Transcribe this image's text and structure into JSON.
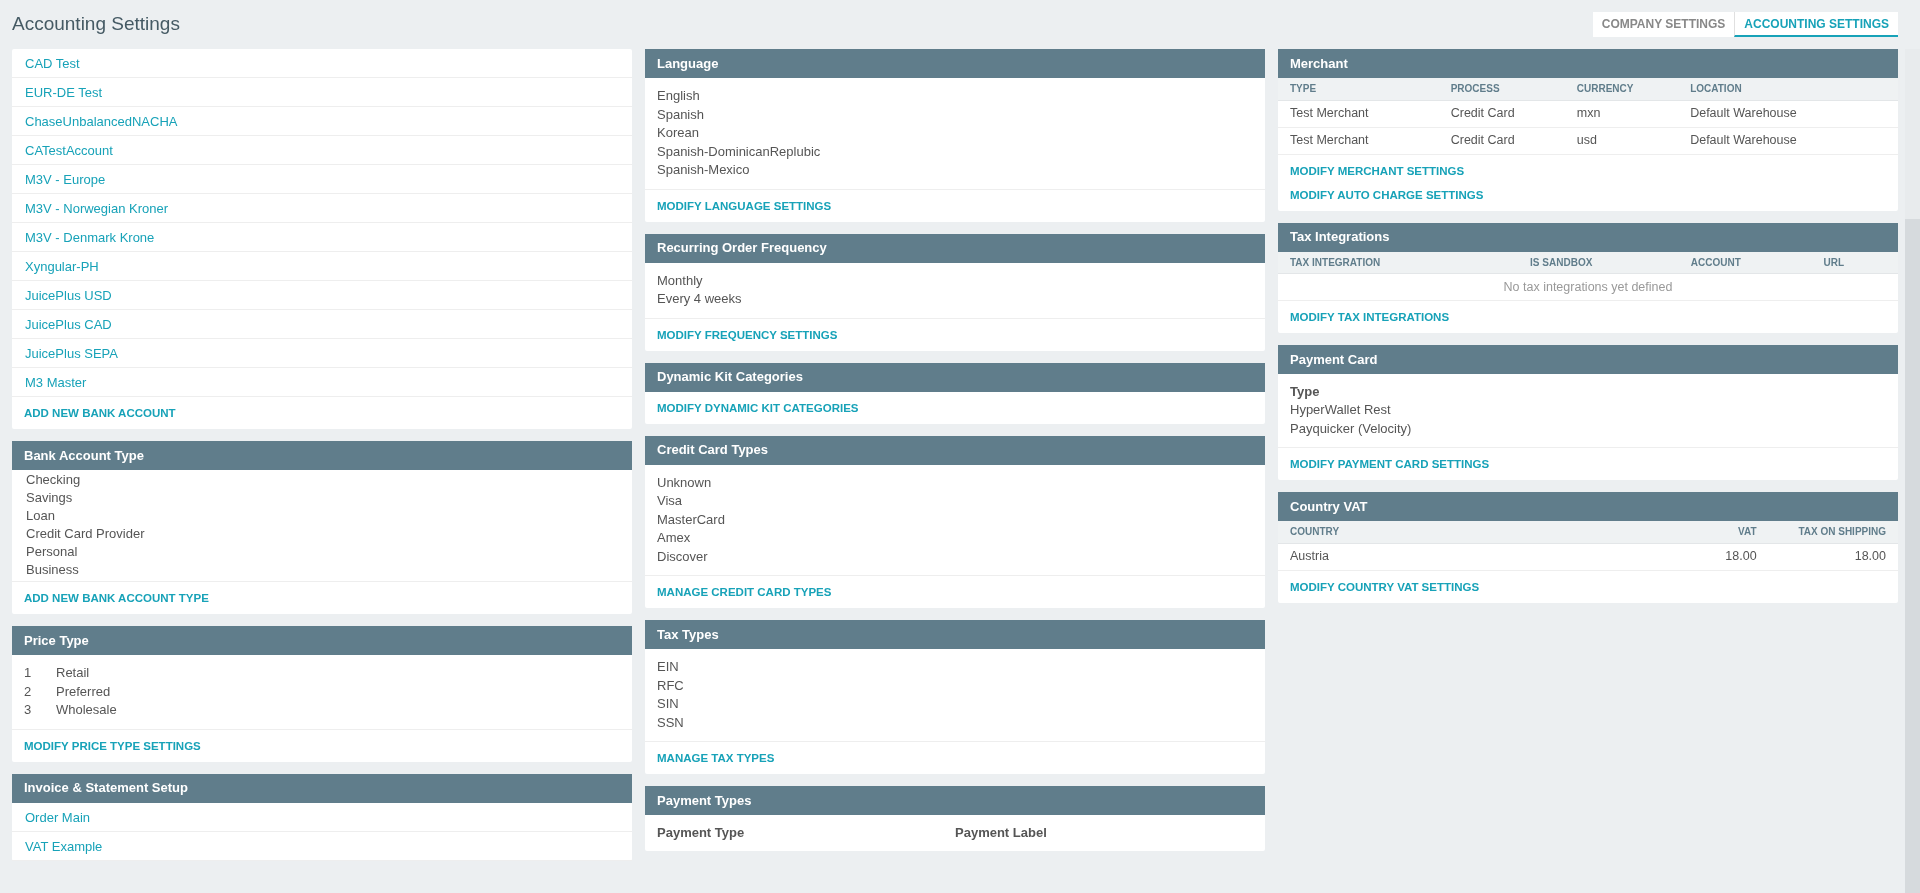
{
  "page_title": "Accounting Settings",
  "tabs": [
    {
      "label": "COMPANY SETTINGS",
      "selected": false
    },
    {
      "label": "ACCOUNTING SETTINGS",
      "selected": true
    }
  ],
  "columns": [
    [
      {
        "kind": "links",
        "items": [
          "CAD Test",
          "EUR-DE Test",
          "ChaseUnbalancedNACHA",
          "CATestAccount",
          "M3V - Europe",
          "M3V - Norwegian Kroner",
          "M3V - Denmark Krone",
          "Xyngular-PH",
          "JuicePlus USD",
          "JuicePlus CAD",
          "JuicePlus SEPA",
          "M3 Master"
        ],
        "actions": [
          "ADD NEW BANK ACCOUNT"
        ]
      },
      {
        "kind": "compact_text",
        "title": "Bank Account Type",
        "items": [
          "Checking",
          "Savings",
          "Loan",
          "Credit Card Provider",
          "Personal",
          "Business"
        ],
        "actions": [
          "ADD NEW BANK ACCOUNT TYPE"
        ]
      },
      {
        "kind": "numbered",
        "title": "Price Type",
        "items": [
          {
            "number": "1",
            "label": "Retail"
          },
          {
            "number": "2",
            "label": "Preferred"
          },
          {
            "number": "3",
            "label": "Wholesale"
          }
        ],
        "actions": [
          "MODIFY PRICE TYPE SETTINGS"
        ]
      },
      {
        "kind": "links",
        "title": "Invoice & Statement Setup",
        "items": [
          "Order Main",
          "VAT Example"
        ]
      }
    ],
    [
      {
        "kind": "text",
        "title": "Language",
        "items": [
          "English",
          "Spanish",
          "Korean",
          "Spanish-DominicanReplubic",
          "Spanish-Mexico"
        ],
        "actions": [
          "MODIFY LANGUAGE SETTINGS"
        ]
      },
      {
        "kind": "text",
        "title": "Recurring Order Frequency",
        "items": [
          "Monthly",
          "Every 4 weeks"
        ],
        "actions": [
          "MODIFY FREQUENCY SETTINGS"
        ]
      },
      {
        "kind": "text",
        "title": "Dynamic Kit Categories",
        "actions": [
          "MODIFY DYNAMIC KIT CATEGORIES"
        ]
      },
      {
        "kind": "text",
        "title": "Credit Card Types",
        "items": [
          "Unknown",
          "Visa",
          "MasterCard",
          "Amex",
          "Discover"
        ],
        "actions": [
          "MANAGE CREDIT CARD TYPES"
        ]
      },
      {
        "kind": "text",
        "title": "Tax Types",
        "items": [
          "EIN",
          "RFC",
          "SIN",
          "SSN"
        ],
        "actions": [
          "MANAGE TAX TYPES"
        ]
      },
      {
        "kind": "label_columns",
        "title": "Payment Types",
        "columns": [
          "Payment Type",
          "Payment Label"
        ]
      }
    ],
    [
      {
        "kind": "table",
        "title": "Merchant",
        "columns": [
          "TYPE",
          "PROCESS",
          "CURRENCY",
          "LOCATION"
        ],
        "rows": [
          [
            "Test Merchant",
            "Credit Card",
            "mxn",
            "Default Warehouse"
          ],
          [
            "Test Merchant",
            "Credit Card",
            "usd",
            "Default Warehouse"
          ]
        ],
        "actions": [
          "MODIFY MERCHANT SETTINGS",
          "MODIFY AUTO CHARGE SETTINGS"
        ]
      },
      {
        "kind": "table",
        "title": "Tax Integrations",
        "columns": [
          "TAX INTEGRATION",
          "IS SANDBOX",
          "ACCOUNT",
          "URL"
        ],
        "empty_message": "No tax integrations yet defined",
        "actions": [
          "MODIFY TAX INTEGRATIONS"
        ]
      },
      {
        "kind": "text",
        "title": "Payment Card",
        "label": "Type",
        "items": [
          "HyperWallet Rest",
          "Payquicker (Velocity)"
        ],
        "actions": [
          "MODIFY PAYMENT CARD SETTINGS"
        ]
      },
      {
        "kind": "numeric_table",
        "title": "Country VAT",
        "columns": [
          "COUNTRY",
          "VAT",
          "TAX ON SHIPPING"
        ],
        "rows": [
          [
            "Austria",
            "18.00",
            "18.00"
          ]
        ],
        "actions": [
          "MODIFY COUNTRY VAT SETTINGS"
        ]
      }
    ]
  ]
}
